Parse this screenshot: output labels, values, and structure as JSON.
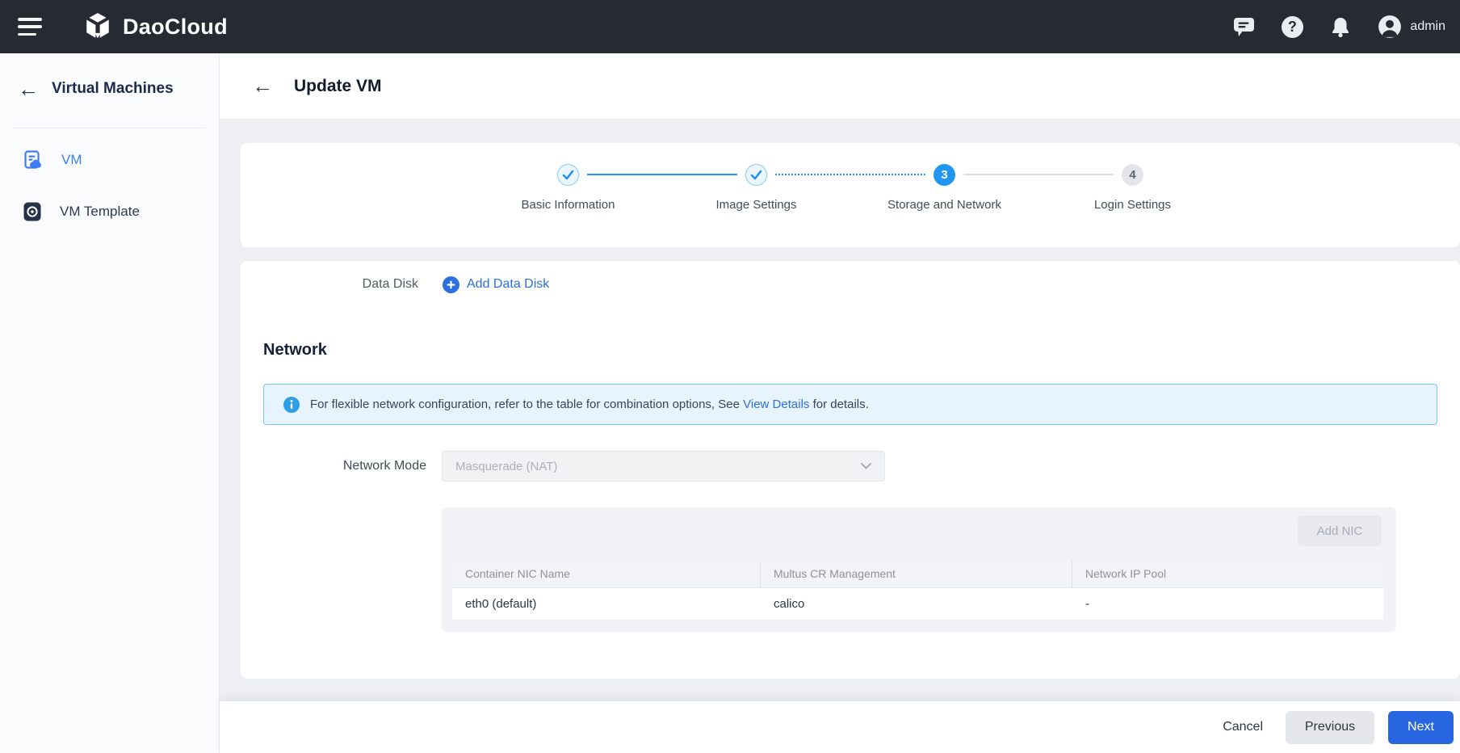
{
  "topbar": {
    "brand": "DaoCloud",
    "user": "admin"
  },
  "sidebar": {
    "title": "Virtual Machines",
    "items": [
      {
        "label": "VM",
        "active": true
      },
      {
        "label": "VM Template",
        "active": false
      }
    ]
  },
  "page": {
    "title": "Update VM"
  },
  "stepper": {
    "steps": [
      {
        "label": "Basic Information",
        "state": "done"
      },
      {
        "label": "Image Settings",
        "state": "done"
      },
      {
        "label": "Storage and Network",
        "state": "current",
        "number": "3"
      },
      {
        "label": "Login Settings",
        "state": "upcoming",
        "number": "4"
      }
    ]
  },
  "content": {
    "data_disk": {
      "label": "Data Disk",
      "add_link": "Add Data Disk"
    },
    "network": {
      "heading": "Network",
      "info_before": "For flexible network configuration, refer to the table for combination options, See",
      "info_link": "View Details",
      "info_after": "for details.",
      "mode_label": "Network Mode",
      "mode_value": "Masquerade (NAT)",
      "add_nic": "Add NIC",
      "table": {
        "columns": [
          "Container NIC Name",
          "Multus CR Management",
          "Network IP Pool"
        ],
        "rows": [
          [
            "eth0 (default)",
            "calico",
            "-"
          ]
        ]
      }
    }
  },
  "footer": {
    "cancel": "Cancel",
    "previous": "Previous",
    "next": "Next"
  },
  "icons": {
    "topbar": [
      "hamburger-icon",
      "daocloud-logo",
      "chat-icon",
      "help-icon",
      "bell-icon",
      "avatar-icon"
    ],
    "sidebar": [
      "back-arrow-icon",
      "vm-icon",
      "vm-template-icon"
    ],
    "content": [
      "back-arrow-icon",
      "check-icon",
      "plus-circle-icon",
      "info-icon",
      "chevron-down-icon"
    ]
  },
  "colors": {
    "topbar-bg": "#262b33",
    "content-bg": "#edeff3",
    "sidebar-bg": "#fafbfd",
    "primary-blue": "#2766e0",
    "link-blue": "#2e6fdf",
    "stepper-blue": "#2196f0",
    "sidebar-active": "#3d7ef7",
    "banner-bg": "#e7f4fd",
    "banner-border": "#7cc3ef",
    "heading-dark": "#16213a"
  }
}
